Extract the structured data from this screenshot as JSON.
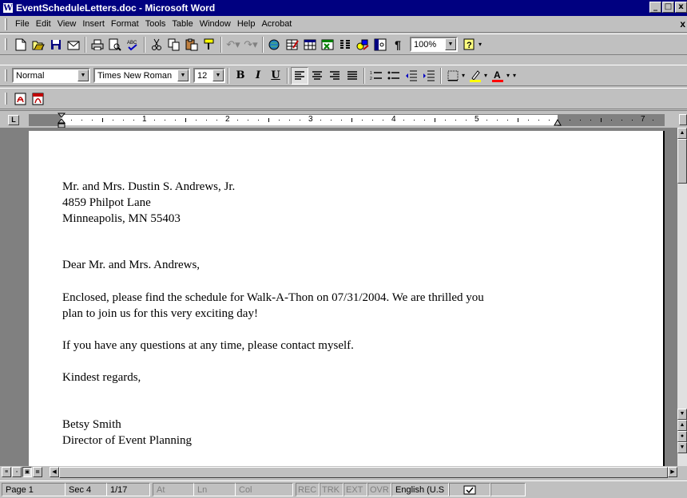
{
  "window": {
    "title": "EventScheduleLetters.doc - Microsoft Word",
    "controls": [
      "_",
      "□",
      "x"
    ]
  },
  "menu": {
    "items": [
      "File",
      "Edit",
      "View",
      "Insert",
      "Format",
      "Tools",
      "Table",
      "Window",
      "Help",
      "Acrobat"
    ],
    "close": "x"
  },
  "standard_toolbar": {
    "zoom": "100%",
    "buttons": [
      "new-icon",
      "open-icon",
      "save-icon",
      "email-icon",
      "print-icon",
      "print-preview-icon",
      "spelling-icon",
      "cut-icon",
      "copy-icon",
      "paste-icon",
      "format-painter-icon",
      "undo-icon",
      "redo-icon",
      "hyperlink-icon",
      "tables-borders-icon",
      "insert-table-icon",
      "insert-excel-icon",
      "columns-icon",
      "drawing-icon",
      "document-map-icon",
      "show-hide-icon",
      "help-icon"
    ]
  },
  "formatting_toolbar": {
    "style": "Normal",
    "font": "Times New Roman",
    "size": "12",
    "bold": "B",
    "italic": "I",
    "underline": "U",
    "highlight_color": "#ffff00",
    "font_color": "#ff0000"
  },
  "ruler": {
    "numbers": [
      "1",
      "2",
      "3",
      "4",
      "5",
      "7"
    ]
  },
  "document": {
    "address": [
      "Mr. and Mrs. Dustin S. Andrews, Jr.",
      "4859 Philpot Lane",
      "Minneapolis, MN 55403"
    ],
    "salutation": "Dear Mr. and Mrs. Andrews,",
    "body1": [
      "Enclosed, please find the schedule for Walk-A-Thon on 07/31/2004. We are thrilled you",
      "plan to join us for this very exciting day!"
    ],
    "body2": "If you have any questions at any time, please contact myself.",
    "closing": "Kindest regards,",
    "signature": [
      "Betsy Smith",
      "Director of Event Planning"
    ]
  },
  "status": {
    "page": "Page 1",
    "sec": "Sec 4",
    "pages": "1/17",
    "at": "At",
    "ln": "Ln",
    "col": "Col",
    "rec": "REC",
    "trk": "TRK",
    "ext": "EXT",
    "ovr": "OVR",
    "language": "English (U.S"
  }
}
